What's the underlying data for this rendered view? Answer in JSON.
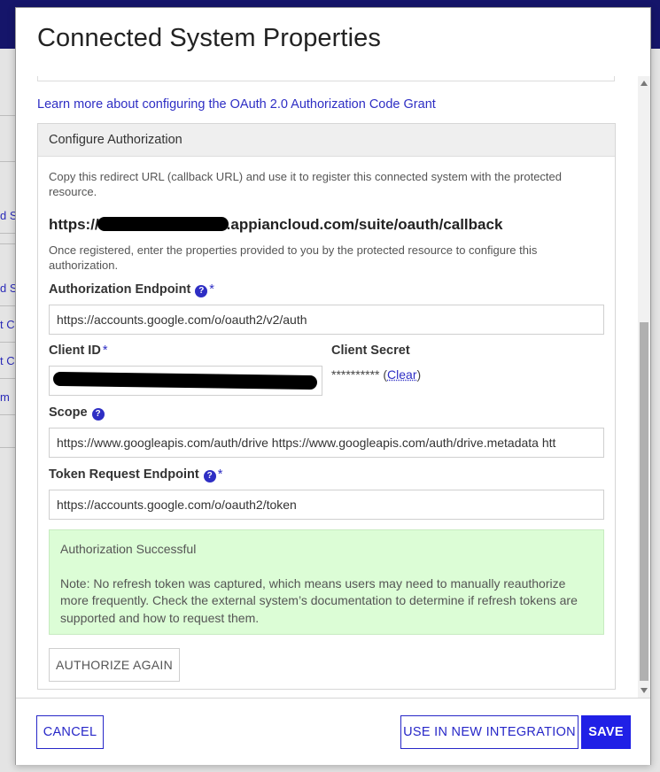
{
  "dialog": {
    "title": "Connected System Properties"
  },
  "learn_more_link": "Learn more about configuring the OAuth 2.0 Authorization Code Grant",
  "configure_authorization": {
    "header": "Configure Authorization",
    "redirect_help": "Copy this redirect URL (callback URL) and use it to register this connected system with the protected resource.",
    "callback_url_prefix": "https://",
    "callback_url_suffix": ".appiancloud.com/suite/oauth/callback",
    "registered_help": "Once registered, enter the properties provided to you by the protected resource to configure this authorization."
  },
  "fields": {
    "authorization_endpoint": {
      "label": "Authorization Endpoint",
      "required_marker": "*",
      "value": "https://accounts.google.com/o/oauth2/v2/auth"
    },
    "client_id": {
      "label": "Client ID",
      "required_marker": "*"
    },
    "client_secret": {
      "label": "Client Secret",
      "value": "**********",
      "clear_label": "Clear"
    },
    "scope": {
      "label": "Scope",
      "value": "https://www.googleapis.com/auth/drive https://www.googleapis.com/auth/drive.metadata htt"
    },
    "token_request_endpoint": {
      "label": "Token Request Endpoint",
      "required_marker": "*",
      "value": "https://accounts.google.com/o/oauth2/token"
    }
  },
  "success_message": {
    "title": "Authorization Successful",
    "note": "Note: No refresh token was captured, which means users may need to manually reauthorize more frequently. Check the external system’s documentation to determine if refresh tokens are supported and how to request them."
  },
  "authorize_again_label": "AUTHORIZE AGAIN",
  "footer": {
    "cancel_label": "CANCEL",
    "use_in_integration_label": "USE IN NEW INTEGRATION",
    "save_label": "SAVE"
  },
  "background_stubs": [
    "d S",
    "d S",
    "t C",
    "t C",
    "m"
  ],
  "icons": {
    "help": "question-circle-icon",
    "help_glyph": "?"
  },
  "colors": {
    "accent": "#2e2ec4",
    "primary_button": "#2020e6",
    "success_bg": "#dcfdd6",
    "top_bar": "#15156a"
  }
}
